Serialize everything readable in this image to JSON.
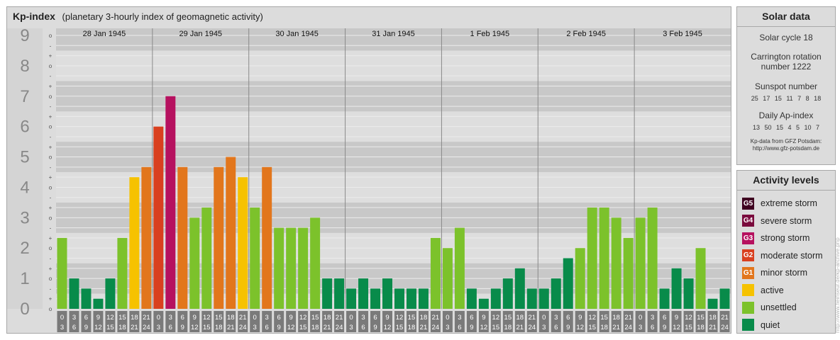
{
  "header": {
    "title": "Kp-index",
    "subtitle": "(planetary 3-hourly index of geomagnetic activity)"
  },
  "chart_data": {
    "type": "bar",
    "y_range": [
      0,
      9
    ],
    "y_ticks": [
      "0",
      "1",
      "2",
      "3",
      "4",
      "5",
      "6",
      "7",
      "8",
      "9"
    ],
    "y_subticks": [
      "-",
      "o",
      "+"
    ],
    "days": [
      "28 Jan 1945",
      "29 Jan 1945",
      "30 Jan 1945",
      "31 Jan 1945",
      "1 Feb 1945",
      "2 Feb 1945",
      "3 Feb 1945"
    ],
    "intervals": [
      {
        "start": "0",
        "end": "3"
      },
      {
        "start": "3",
        "end": "6"
      },
      {
        "start": "6",
        "end": "9"
      },
      {
        "start": "9",
        "end": "12"
      },
      {
        "start": "12",
        "end": "15"
      },
      {
        "start": "15",
        "end": "18"
      },
      {
        "start": "18",
        "end": "21"
      },
      {
        "start": "21",
        "end": "24"
      }
    ],
    "kp_values": [
      [
        2.333,
        1.0,
        0.667,
        0.333,
        1.0,
        2.333,
        4.333,
        4.667
      ],
      [
        6.0,
        7.0,
        4.667,
        3.0,
        3.333,
        4.667,
        5.0,
        4.333
      ],
      [
        3.333,
        4.667,
        2.667,
        2.667,
        2.667,
        3.0,
        1.0,
        1.0
      ],
      [
        0.667,
        1.0,
        0.667,
        1.0,
        0.667,
        0.667,
        0.667,
        2.333
      ],
      [
        2.0,
        2.667,
        0.667,
        0.333,
        0.667,
        1.0,
        1.333,
        0.667
      ],
      [
        0.667,
        1.0,
        1.667,
        2.0,
        3.333,
        3.333,
        3.0,
        2.333
      ],
      [
        3.0,
        3.333,
        0.667,
        1.333,
        1.0,
        2.0,
        0.333,
        0.667
      ]
    ],
    "colors": {
      "quiet": "#088b4a",
      "unsettled": "#7cc22b",
      "active": "#f6c200",
      "minor": "#e2761c",
      "moderate": "#d9401f",
      "strong": "#b6115f",
      "severe": "#7a0b3d",
      "extreme": "#3f0020"
    }
  },
  "solar": {
    "title": "Solar data",
    "cycle": "Solar cycle 18",
    "carrington_line1": "Carrington rotation",
    "carrington_line2": "number 1222",
    "sunspot_label": "Sunspot number",
    "sunspot_values": "25 17 15 11 7 8 18",
    "ap_label": "Daily Ap-index",
    "ap_values": "13 50 15 4 5 10 7",
    "credit_line1": "Kp-data from GFZ Potsdam:",
    "credit_line2": "http://www.gfz-potsdam.de"
  },
  "activity": {
    "title": "Activity levels",
    "levels": [
      {
        "badge": "G5",
        "label": "extreme storm",
        "color": "#3f0020"
      },
      {
        "badge": "G4",
        "label": "severe storm",
        "color": "#7a0b3d"
      },
      {
        "badge": "G3",
        "label": "strong storm",
        "color": "#b6115f"
      },
      {
        "badge": "G2",
        "label": "moderate storm",
        "color": "#d9401f"
      },
      {
        "badge": "G1",
        "label": "minor storm",
        "color": "#e2761c"
      },
      {
        "badge": "",
        "label": "active",
        "color": "#f6c200"
      },
      {
        "badge": "",
        "label": "unsettled",
        "color": "#7cc22b"
      },
      {
        "badge": "",
        "label": "quiet",
        "color": "#088b4a"
      }
    ]
  },
  "watermark": "http://www.fieinseur.de/kp-archive.php"
}
